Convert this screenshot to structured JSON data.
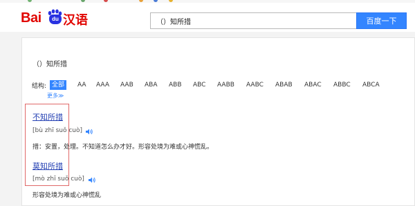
{
  "colors": {
    "accent": "#3385ff",
    "logo_red": "#e10602",
    "logo_blue": "#2932e1",
    "link": "#2440b3",
    "highlight_box": "#e06868"
  },
  "header": {
    "logo": {
      "text_bai": "Bai",
      "text_du": "du",
      "text_han": "汉语"
    },
    "search": {
      "value": "（）知所措"
    },
    "search_button": "百度一下"
  },
  "main": {
    "query_title": "（）知所措",
    "structure": {
      "label": "结构:",
      "tags": [
        "全部",
        "AA",
        "AAA",
        "AAB",
        "ABA",
        "ABB",
        "ABC",
        "AABB",
        "AABC",
        "ABAB",
        "ABAC",
        "ABBC",
        "ABCA"
      ],
      "selected": "全部",
      "more": "更多≫"
    },
    "results": [
      {
        "word": "不知所措",
        "pinyin": "[bù zhī suǒ cuò]",
        "definition": "措：安置，处理。不知道怎么办才好。形容处境为难或心神慌乱。"
      },
      {
        "word": "莫知所措",
        "pinyin": "[mò zhī suǒ cuò]",
        "definition": "形容处境为难或心神慌乱"
      }
    ]
  }
}
